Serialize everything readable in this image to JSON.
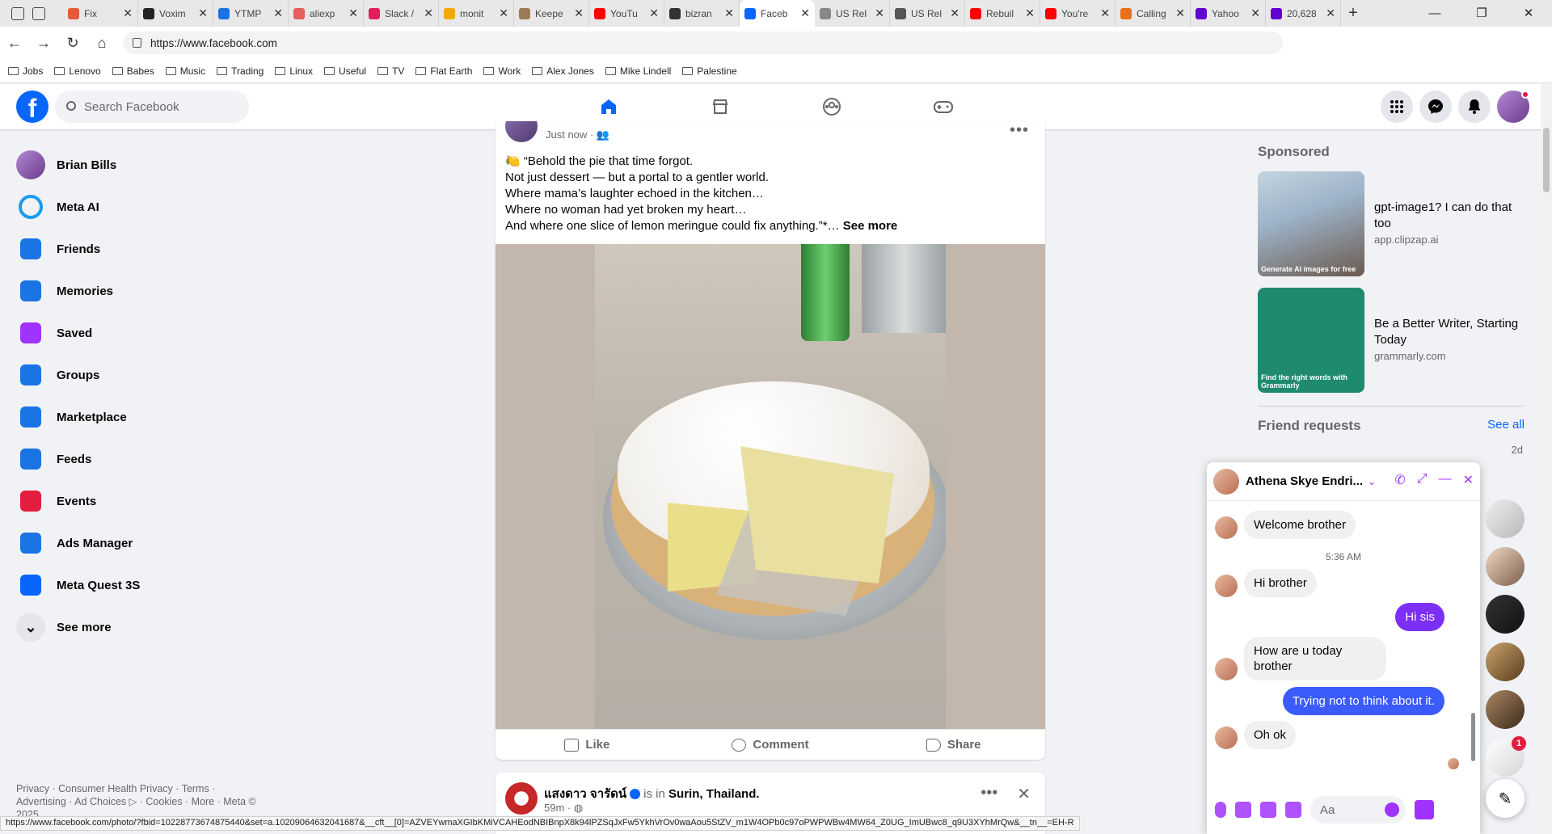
{
  "browser": {
    "tabs": [
      {
        "title": "Fix",
        "color": "#e8583a"
      },
      {
        "title": "Voxim",
        "color": "#222222"
      },
      {
        "title": "YTMP",
        "color": "#1a73e8"
      },
      {
        "title": "aliexp",
        "color": "#e85d5d"
      },
      {
        "title": "Slack /",
        "color": "#e01e5a"
      },
      {
        "title": "monit",
        "color": "#f2a900"
      },
      {
        "title": "Keepe",
        "color": "#9b7b57"
      },
      {
        "title": "YouTu",
        "color": "#ff0000"
      },
      {
        "title": "bizran",
        "color": "#333333"
      },
      {
        "title": "Faceb",
        "color": "#0866ff",
        "active": true
      },
      {
        "title": "US Rel",
        "color": "#888888"
      },
      {
        "title": "US Rel",
        "color": "#555555"
      },
      {
        "title": "Rebuil",
        "color": "#ff0000"
      },
      {
        "title": "You're",
        "color": "#ff0000"
      },
      {
        "title": "Calling",
        "color": "#e8701a"
      },
      {
        "title": "Yahoo",
        "color": "#6001d2"
      },
      {
        "title": "20,628",
        "color": "#6001d2"
      }
    ],
    "url": "https://www.facebook.com",
    "bookmarks": [
      "Jobs",
      "Lenovo",
      "Babes",
      "Music",
      "Trading",
      "Linux",
      "Useful",
      "TV",
      "Flat Earth",
      "Work",
      "Alex Jones",
      "Mike Lindell",
      "Palestine"
    ],
    "status_url": "https://www.facebook.com/photo/?fbid=10228773674875440&set=a.10209064632041687&__cft__[0]=AZVEYwmaXGIbKMiVCAHEodNBIBnpX8k94lPZSqJxFw5YkhVrOv0waAou5StZV_m1W4OPb0c97oPWPWBw4MW64_Z0UG_ImUBwc8_q9U3XYhMrQw&__tn__=EH-R"
  },
  "fb": {
    "search_placeholder": "Search Facebook",
    "sidebar": [
      {
        "label": "Brian Bills",
        "icon": "profile-avatar",
        "color": "#6a3b8a"
      },
      {
        "label": "Meta AI",
        "icon": "meta-ai-icon",
        "color": "#1d9bf0"
      },
      {
        "label": "Friends",
        "icon": "friends-icon",
        "color": "#1b74e4"
      },
      {
        "label": "Memories",
        "icon": "memories-icon",
        "color": "#1b74e4"
      },
      {
        "label": "Saved",
        "icon": "saved-icon",
        "color": "#a033ff"
      },
      {
        "label": "Groups",
        "icon": "groups-icon",
        "color": "#1b74e4"
      },
      {
        "label": "Marketplace",
        "icon": "marketplace-icon",
        "color": "#1b74e4"
      },
      {
        "label": "Feeds",
        "icon": "feeds-icon",
        "color": "#1b74e4"
      },
      {
        "label": "Events",
        "icon": "events-icon",
        "color": "#e41e3f"
      },
      {
        "label": "Ads Manager",
        "icon": "ads-manager-icon",
        "color": "#1b74e4"
      },
      {
        "label": "Meta Quest 3S",
        "icon": "meta-quest-icon",
        "color": "#0866ff"
      },
      {
        "label": "See more",
        "icon": "chevron-down-icon",
        "color": "#e4e6eb"
      }
    ],
    "footer": "Privacy · Consumer Health Privacy · Terms · Advertising · Ad Choices ▷ · Cookies · More · Meta © 2025",
    "post": {
      "time": "Just now",
      "lines": [
        "🍋 “Behold the pie that time forgot.",
        "Not just dessert — but a portal to a gentler world.",
        "Where mama’s laughter echoed in the kitchen…",
        "Where no woman had yet broken my heart…"
      ],
      "last_line": "And where one slice of lemon meringue could fix anything.”*… ",
      "see_more": "See more",
      "like": "Like",
      "comment": "Comment",
      "share": "Share"
    },
    "post2": {
      "name": "แสงดาว จารัดน์",
      "is_in": "is in",
      "place": "Surin, Thailand.",
      "time": "59m ·"
    },
    "right": {
      "sponsored": "Sponsored",
      "ads": [
        {
          "title": "gpt-image1? I can do that too",
          "domain": "app.clipzap.ai",
          "caption": "Generate AI images for free"
        },
        {
          "title": "Be a Better Writer, Starting Today",
          "domain": "grammarly.com",
          "caption": "Find the right words with Grammarly"
        }
      ],
      "friend_requests": "Friend requests",
      "see_all": "See all",
      "fr_age": "2d"
    },
    "chat": {
      "name": "Athena Skye Endri...",
      "time_divider": "5:36 AM",
      "messages": [
        {
          "text": "Welcome brother",
          "dir": "in"
        },
        {
          "text": "Hi brother",
          "dir": "in"
        },
        {
          "text": "Hi sis",
          "dir": "out"
        },
        {
          "text": "How are u today brother",
          "dir": "in"
        },
        {
          "text": "Trying not to think about it.",
          "dir": "out"
        },
        {
          "text": "Oh ok",
          "dir": "in"
        }
      ],
      "input_placeholder": "Aa",
      "badge": "1"
    }
  }
}
